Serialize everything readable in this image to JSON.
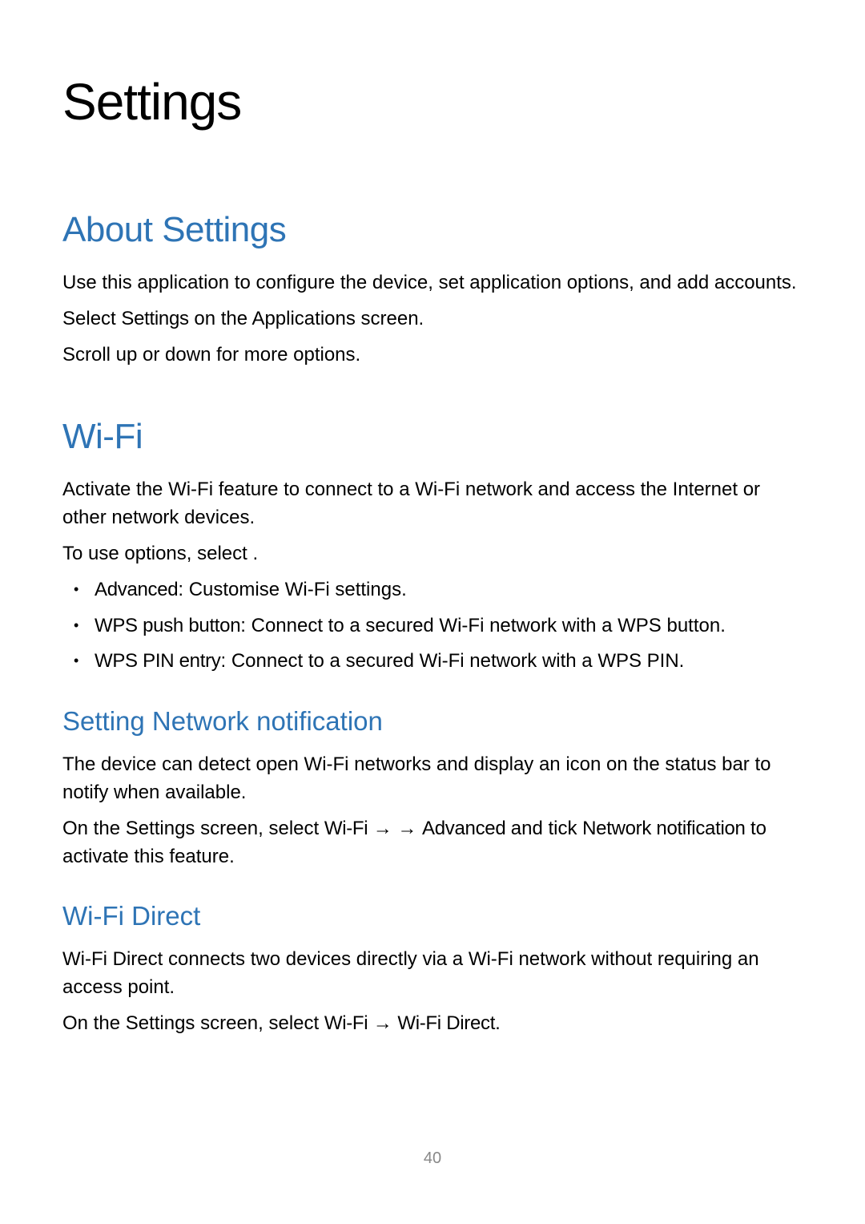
{
  "page": {
    "title": "Settings",
    "number": "40"
  },
  "about": {
    "heading": "About Settings",
    "p1_pre": "Use this application to configure the device, set application options, and add accounts.",
    "p2_pre": "Select ",
    "p2_bold": "Settings",
    "p2_post": " on the Applications screen.",
    "p3": "Scroll up or down for more options."
  },
  "wifi": {
    "heading": "Wi-Fi",
    "intro": "Activate the Wi-Fi feature to connect to a Wi-Fi network and access the Internet or other network devices.",
    "options_pre": "To use options, select ",
    "options_post": ".",
    "items": [
      {
        "label": "Advanced",
        "sep": ": ",
        "desc": "Customise Wi-Fi settings."
      },
      {
        "label": "WPS push button",
        "sep": ": ",
        "desc": "Connect to a secured Wi-Fi network with a WPS button."
      },
      {
        "label": "WPS PIN entry",
        "sep": ": ",
        "desc": "Connect to a secured Wi-Fi network with a WPS PIN."
      }
    ],
    "network_notification": {
      "heading": "Setting Network notification",
      "p1": "The device can detect open Wi-Fi networks and display an icon on the status bar to notify when available.",
      "p2_pre": "On the Settings screen, select ",
      "p2_wifi": "Wi-Fi ",
      "p2_arrow1": "→ ",
      "p2_gap": "   ",
      "p2_arrow2": "→ ",
      "p2_adv": "Advanced ",
      "p2_mid": "and tick ",
      "p2_nn": "Network notification ",
      "p2_post": " to activate this feature."
    },
    "direct": {
      "heading": "Wi-Fi Direct",
      "p1": "Wi-Fi Direct connects two devices directly via a Wi-Fi network without requiring an access point.",
      "p2_pre": "On the Settings screen, select ",
      "p2_wifi": "Wi-Fi ",
      "p2_arrow": "→ ",
      "p2_wd": "Wi-Fi Direct",
      "p2_post": "."
    }
  }
}
